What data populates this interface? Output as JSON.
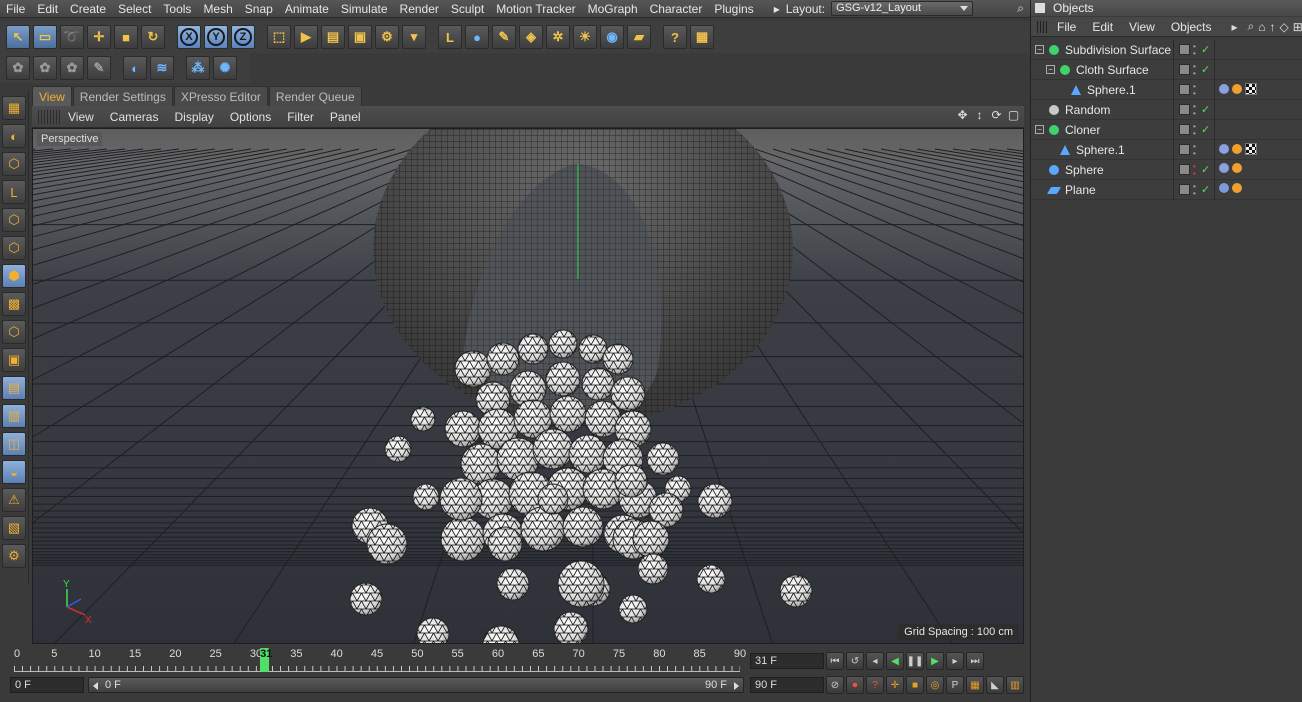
{
  "menubar": {
    "items": [
      "File",
      "Edit",
      "Create",
      "Select",
      "Tools",
      "Mesh",
      "Snap",
      "Animate",
      "Simulate",
      "Render",
      "Sculpt",
      "Motion Tracker",
      "MoGraph",
      "Character",
      "Plugins"
    ],
    "layout_label": "Layout:",
    "layout_value": "GSG-v12_Layout"
  },
  "toolbar": {
    "tools": [
      "select-tool",
      "rect-select-tool",
      "lasso-select-tool",
      "move-tool",
      "scale-tool",
      "rotate-tool",
      "x-axis-lock",
      "y-axis-lock",
      "z-axis-lock",
      "coordinate-system",
      "render-active-view",
      "render-region",
      "render-to-picture-viewer",
      "edit-render-settings",
      "render-settings-dropdown",
      "null-object",
      "sphere-primitive",
      "spline-pen",
      "subdivision-surface",
      "cloner",
      "light",
      "environment",
      "floor",
      "help",
      "content-browser"
    ],
    "xyz": [
      "X",
      "Y",
      "Z"
    ]
  },
  "toolbar2": {
    "tools": [
      "mograph-1",
      "mograph-2",
      "mograph-3",
      "mograph-4",
      "mograph-5",
      "mograph-6",
      "mograph-7",
      "mograph-8"
    ]
  },
  "leftbar": {
    "tools": [
      "make-editable",
      "model-mode",
      "object-mode",
      "axis-mode",
      "points-mode",
      "edges-mode",
      "polygons-mode",
      "texture-mode",
      "workplane",
      "uv-points",
      "uv-polygons",
      "animation-mode",
      "solo",
      "snap",
      "locks",
      "render-preview",
      "render-settings-icon"
    ]
  },
  "tabs": {
    "items": [
      "View",
      "Render Settings",
      "XPresso Editor",
      "Render Queue"
    ],
    "active": 0
  },
  "viewport": {
    "menu": [
      "View",
      "Cameras",
      "Display",
      "Options",
      "Filter",
      "Panel"
    ],
    "projection_label": "Perspective",
    "grid_spacing": "Grid Spacing : 100 cm",
    "axis_y": "Y",
    "axis_x": "X"
  },
  "timeline": {
    "ticks": [
      "0",
      "5",
      "10",
      "15",
      "20",
      "25",
      "30",
      "35",
      "40",
      "45",
      "50",
      "55",
      "60",
      "65",
      "70",
      "75",
      "80",
      "85",
      "90"
    ],
    "current_frame": 31,
    "current_frame_label": "31",
    "max_frame": 90,
    "current_field": "31 F",
    "end_field": "90 F",
    "start_field": "0 F",
    "range_start": "0 F",
    "range_end": "90 F"
  },
  "colors": {
    "accent": "#f0b030",
    "selection": "#6f93c6",
    "check": "#4fe04f"
  },
  "objects_panel": {
    "title": "Objects",
    "menu": [
      "File",
      "Edit",
      "View",
      "Objects"
    ],
    "rows": [
      {
        "name": "Subdivision Surface",
        "indent": 0,
        "icon": "subdivision-icon",
        "icon_color": "#3fd36a",
        "check": "✓",
        "tags": []
      },
      {
        "name": "Cloth Surface",
        "indent": 1,
        "icon": "cloth-surface-icon",
        "icon_color": "#3fd36a",
        "check": "✓",
        "tags": []
      },
      {
        "name": "Sphere.1",
        "indent": 2,
        "icon": "sphere-triangle-icon",
        "icon_color": "#59a7ff",
        "check": "",
        "tags": [
          "cloth-tag",
          "material-tag",
          "checker-material-tag"
        ]
      },
      {
        "name": "Random",
        "indent": 0,
        "icon": "random-effector-icon",
        "icon_color": "#c8c8c8",
        "check": "✓",
        "tags": []
      },
      {
        "name": "Cloner",
        "indent": 0,
        "icon": "cloner-icon",
        "icon_color": "#3fd36a",
        "check": "✓",
        "tags": []
      },
      {
        "name": "Sphere.1",
        "indent": 1,
        "icon": "sphere-triangle-icon",
        "icon_color": "#59a7ff",
        "check": "",
        "tags": [
          "cloth-tag",
          "material-tag",
          "checker-material-tag"
        ]
      },
      {
        "name": "Sphere",
        "indent": 0,
        "icon": "sphere-icon",
        "icon_color": "#59a7ff",
        "check": "✓",
        "tags": [
          "cloth-tag",
          "material-tag"
        ]
      },
      {
        "name": "Plane",
        "indent": 0,
        "icon": "plane-icon",
        "icon_color": "#59a7ff",
        "check": "✓",
        "tags": [
          "collider-tag",
          "material-tag"
        ]
      }
    ]
  }
}
